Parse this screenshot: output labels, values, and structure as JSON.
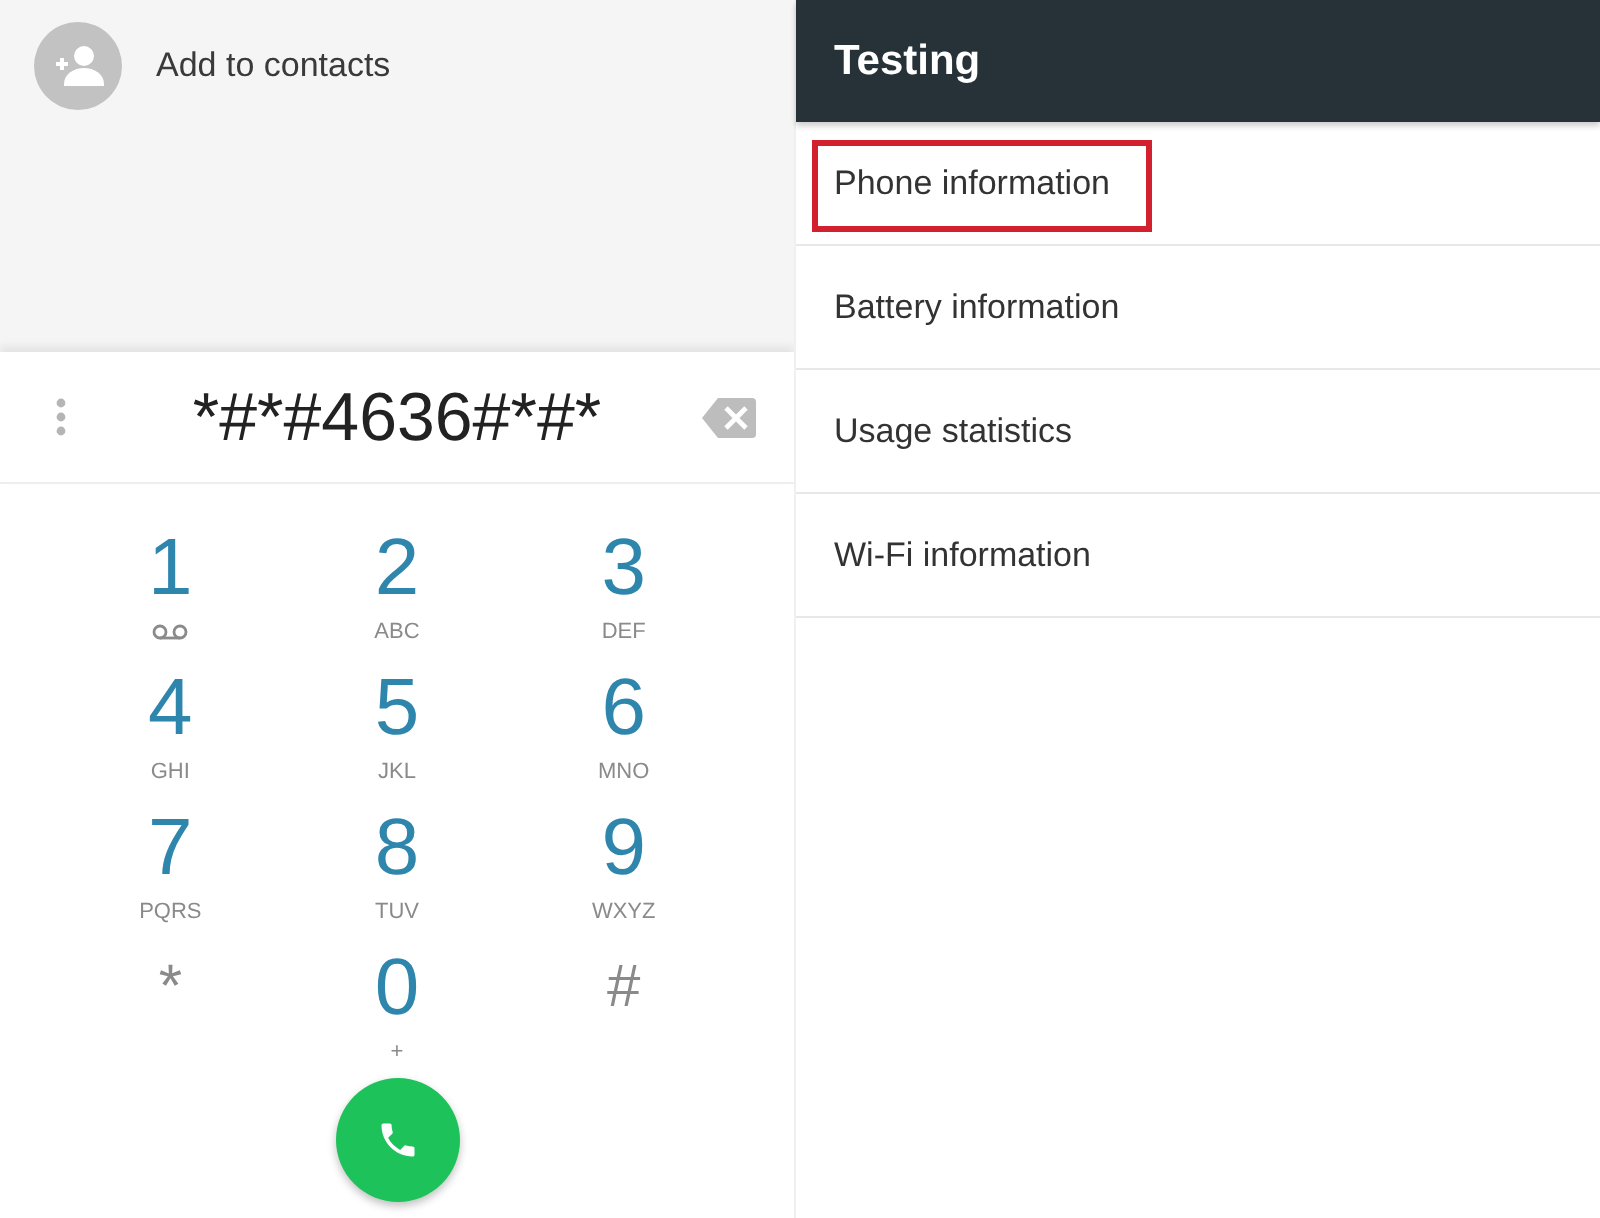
{
  "dialer": {
    "contact_action": {
      "label": "Add to contacts"
    },
    "number": "*#*#4636#*#*",
    "keys": [
      {
        "kind": "voicemail",
        "digit": "1"
      },
      {
        "kind": "letters",
        "digit": "2",
        "letters": "ABC"
      },
      {
        "kind": "letters",
        "digit": "3",
        "letters": "DEF"
      },
      {
        "kind": "letters",
        "digit": "4",
        "letters": "GHI"
      },
      {
        "kind": "letters",
        "digit": "5",
        "letters": "JKL"
      },
      {
        "kind": "letters",
        "digit": "6",
        "letters": "MNO"
      },
      {
        "kind": "letters",
        "digit": "7",
        "letters": "PQRS"
      },
      {
        "kind": "letters",
        "digit": "8",
        "letters": "TUV"
      },
      {
        "kind": "letters",
        "digit": "9",
        "letters": "WXYZ"
      },
      {
        "kind": "symbol",
        "digit": "*"
      },
      {
        "kind": "letters",
        "digit": "0",
        "letters": "+"
      },
      {
        "kind": "symbol",
        "digit": "#"
      }
    ]
  },
  "testing": {
    "title": "Testing",
    "items": [
      {
        "label": "Phone information",
        "highlighted": true
      },
      {
        "label": "Battery information",
        "highlighted": false
      },
      {
        "label": "Usage statistics",
        "highlighted": false
      },
      {
        "label": "Wi-Fi information",
        "highlighted": false
      }
    ]
  }
}
